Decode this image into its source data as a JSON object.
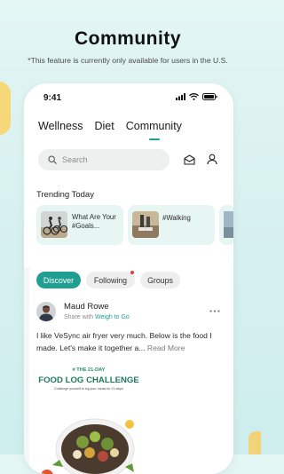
{
  "headline": "Community",
  "subline": "*This feature is currently only available for users in the U.S.",
  "status": {
    "time": "9:41"
  },
  "tabs": [
    {
      "label": "Wellness"
    },
    {
      "label": "Diet"
    },
    {
      "label": "Community"
    }
  ],
  "search": {
    "placeholder": "Search"
  },
  "trending": {
    "title": "Trending Today",
    "cards": [
      {
        "text": "What Are Your #Goals..."
      },
      {
        "text": "#Walking"
      }
    ]
  },
  "filters": {
    "discover": "Discover",
    "following": "Following",
    "groups": "Groups"
  },
  "post": {
    "author": "Maud Rowe",
    "share_prefix": "Share with",
    "share_group": "Weigh to Go",
    "text": "I like VeSync air fryer very much. Below is the food I made. Let's make it together a...",
    "read_more": "Read More",
    "image": {
      "kicker": "# THE 21-DAY",
      "title": "FOOD LOG CHALLENGE",
      "sub": "Challenge yourself to log your meals for 21 days!"
    }
  },
  "colors": {
    "accent": "#1f9e91",
    "background": "#d6f0ef",
    "notification_dot": "#e23b3b"
  }
}
